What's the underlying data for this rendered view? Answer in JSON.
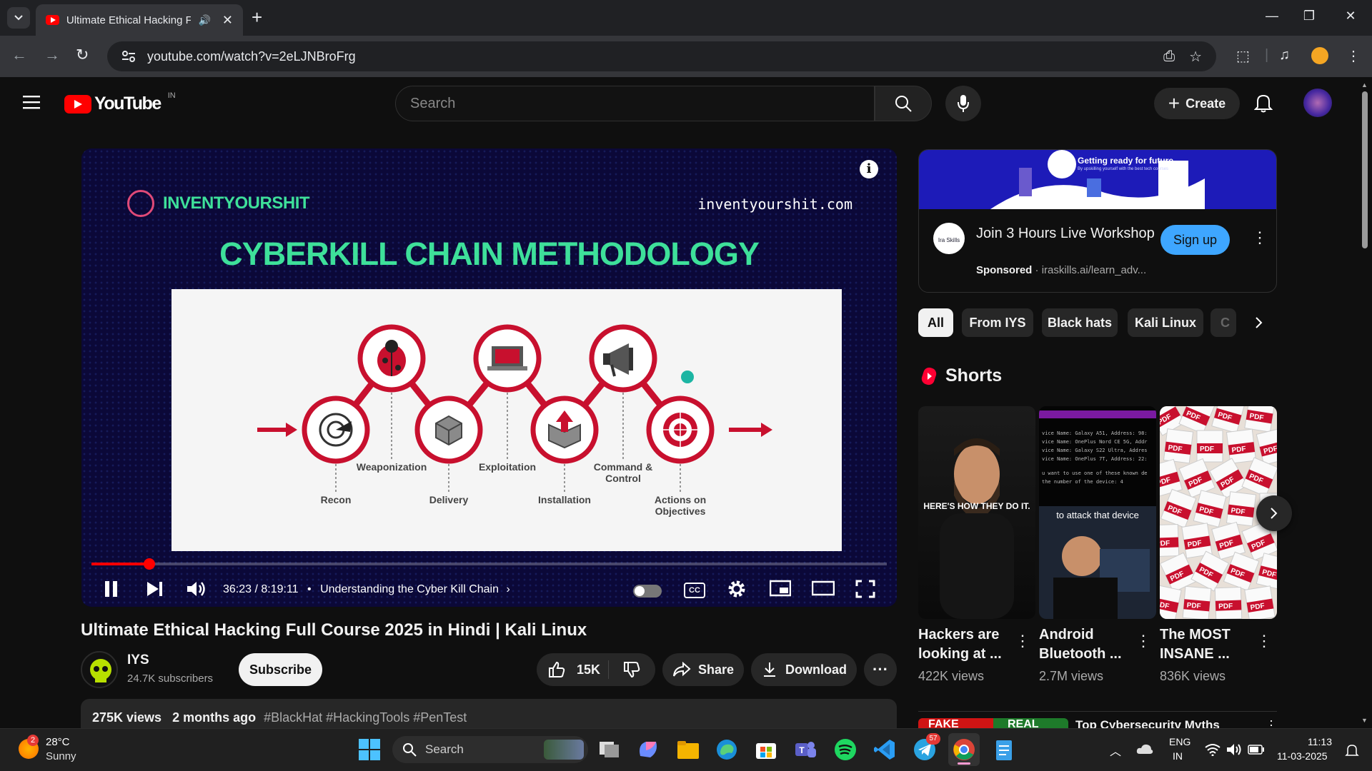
{
  "browser": {
    "tab_title": "Ultimate Ethical Hacking Full Course 2025 in Hindi | Kali Linux",
    "url": "youtube.com/watch?v=2eLJNBroFrg"
  },
  "youtube": {
    "logo_text": "YouTube",
    "country": "IN",
    "search_placeholder": "Search",
    "create_label": "Create"
  },
  "video": {
    "slide_brand": "INVENTYOURSHIT",
    "slide_site": "inventyourshit.com",
    "slide_heading": "CYBERKILL CHAIN METHODOLOGY",
    "stages": [
      "Recon",
      "Weaponization",
      "Delivery",
      "Exploitation",
      "Installation",
      "Command & Control",
      "Actions on Objectives"
    ],
    "time": "36:23 / 8:19:11",
    "chapter": "Understanding the Cyber Kill Chain",
    "progress": 0.073
  },
  "meta": {
    "title": "Ultimate Ethical Hacking Full Course 2025 in Hindi | Kali Linux",
    "channel": "IYS",
    "subscribers": "24.7K subscribers",
    "subscribe": "Subscribe",
    "likes": "15K",
    "share": "Share",
    "download": "Download",
    "views": "275K views",
    "age": "2 months ago",
    "tags": "#BlackHat #HackingTools #PenTest"
  },
  "ad": {
    "banner_text": "Getting ready for future",
    "banner_sub": "By upskilling yourself with the best tech courses",
    "logo_text": "Ira Skills",
    "title": "Join 3 Hours Live Workshop",
    "sponsored": "Sponsored",
    "domain": "iraskills.ai/learn_adv...",
    "cta": "Sign up"
  },
  "chips": [
    "All",
    "From IYS",
    "Black hats",
    "Kali Linux",
    "C"
  ],
  "shorts": {
    "heading": "Shorts",
    "items": [
      {
        "title": "Hackers are looking at ...",
        "views": "422K views",
        "overlay": "HERE'S HOW THEY DO IT."
      },
      {
        "title": "Android Bluetooth ...",
        "views": "2.7M views",
        "overlay": "to attack that device"
      },
      {
        "title": "The MOST INSANE ...",
        "views": "836K views",
        "overlay": "PDF"
      }
    ]
  },
  "next_item": {
    "title": "Top Cybersecurity Myths",
    "thumb_left": "FAKE",
    "thumb_right": "REAL"
  },
  "taskbar": {
    "weather_temp": "28°C",
    "weather_desc": "Sunny",
    "weather_badge": "2",
    "search": "Search",
    "telegram_badge": "57",
    "lang1": "ENG",
    "lang2": "IN",
    "time": "11:13",
    "date": "11-03-2025"
  }
}
